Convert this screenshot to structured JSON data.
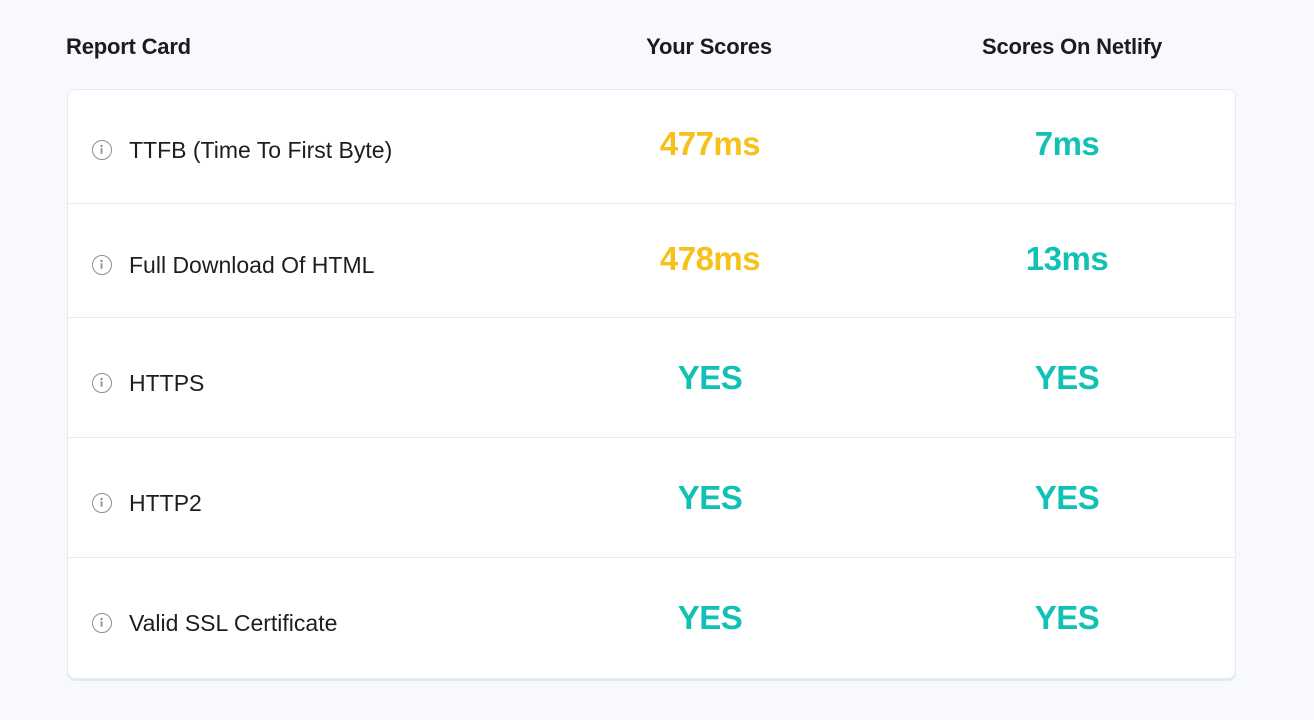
{
  "header": {
    "label": "Report Card",
    "yours": "Your Scores",
    "netlify": "Scores On Netlify"
  },
  "colors": {
    "warning": "#f6c11a",
    "good": "#12c1b5"
  },
  "rows": [
    {
      "label": "TTFB (Time To First Byte)",
      "yours": "477ms",
      "yours_status": "warning",
      "netlify": "7ms",
      "netlify_status": "good"
    },
    {
      "label": "Full Download Of HTML",
      "yours": "478ms",
      "yours_status": "warning",
      "netlify": "13ms",
      "netlify_status": "good"
    },
    {
      "label": "HTTPS",
      "yours": "YES",
      "yours_status": "good",
      "netlify": "YES",
      "netlify_status": "good"
    },
    {
      "label": "HTTP2",
      "yours": "YES",
      "yours_status": "good",
      "netlify": "YES",
      "netlify_status": "good"
    },
    {
      "label": "Valid SSL Certificate",
      "yours": "YES",
      "yours_status": "good",
      "netlify": "YES",
      "netlify_status": "good"
    }
  ]
}
